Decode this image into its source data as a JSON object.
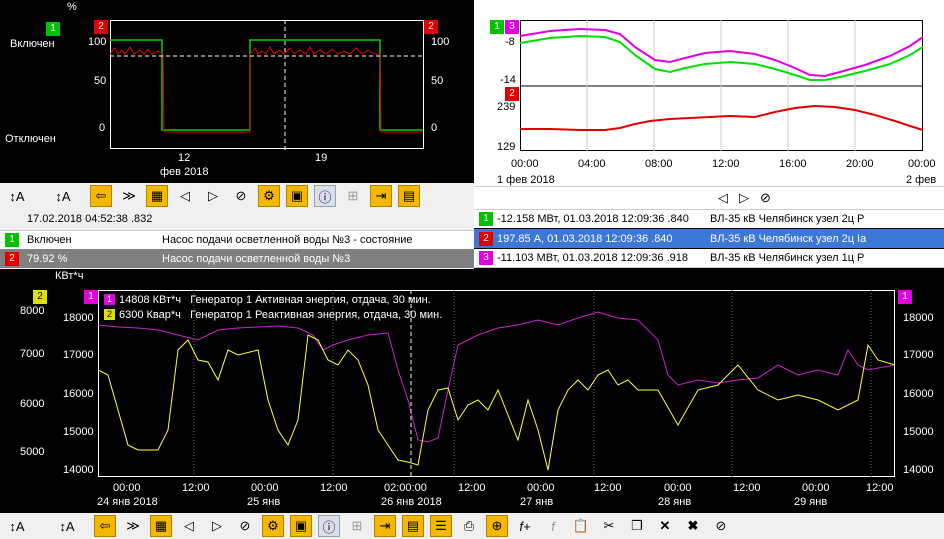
{
  "colors": {
    "green": "#00e000",
    "red": "#e00000",
    "magenta": "#e000e0",
    "yellow": "#ffff40",
    "blue_sel": "#3c78d8"
  },
  "top_left": {
    "unit": "%",
    "state_on": "Включен",
    "state_off": "Отключен",
    "ticks_left": [
      "100",
      "50",
      "0"
    ],
    "ticks_right": [
      "100",
      "50",
      "0"
    ],
    "x_ticks": [
      "12",
      "19"
    ],
    "x_sub": "фев 2018",
    "badge_left": "1",
    "badge_red": "2",
    "badge_right": "2"
  },
  "top_right": {
    "ticks_top": [
      "-8",
      "-14"
    ],
    "ticks_bottom": [
      "239",
      "129"
    ],
    "x_ticks": [
      "00:00",
      "04:00",
      "08:00",
      "12:00",
      "16:00",
      "20:00",
      "00:00"
    ],
    "date_left": "1 фев 2018",
    "date_right": "2 фев",
    "badge_a": "1",
    "badge_b": "3",
    "badge_c": "2"
  },
  "left_table": {
    "timestamp": "17.02.2018 04:52:38 .832",
    "rows": [
      {
        "badge": "1",
        "value": "Включен",
        "name": "Насос подачи осветленной воды №3 - состояние"
      },
      {
        "badge": "2",
        "value": "79.92 %",
        "name": "Насос подачи осветленной воды №3"
      }
    ]
  },
  "right_table": {
    "rows": [
      {
        "badge": "1",
        "value": "-12.158 МВт,  01.03.2018 12:09:36 .840",
        "name": "ВЛ-35 кВ Челябинск узел 2ц Р"
      },
      {
        "badge": "2",
        "value": "197.85 А,  01.03.2018 12:09:36 .840",
        "name": "ВЛ-35 кВ Челябинск узел 2ц Ia"
      },
      {
        "badge": "3",
        "value": "-11.103 МВт,  01.03.2018 12:09:36 .918",
        "name": "ВЛ-35 кВ Челябинск узел 1ц Р"
      }
    ]
  },
  "bottom": {
    "unit": "КВт*ч",
    "badge_left": "2",
    "badge_right": "1",
    "ticks_left": [
      "8000",
      "7000",
      "6000",
      "5000"
    ],
    "ticks_inner": [
      "18000",
      "17000",
      "16000",
      "15000",
      "14000"
    ],
    "ticks_right": [
      "18000",
      "17000",
      "16000",
      "15000",
      "14000"
    ],
    "legend": [
      {
        "badge": "1",
        "text": "14808 КВт*ч   Генератор 1 Активная энергия, отдача, 30 мин."
      },
      {
        "badge": "2",
        "text": "6300 Квар*ч   Генератор 1 Реактивная энергия, отдача, 30 мин."
      }
    ],
    "x_ticks": [
      "00:00",
      "12:00",
      "00:00",
      "12:00",
      "02:00:00",
      "12:00",
      "00:00",
      "12:00",
      "00:00",
      "12:00",
      "00:00",
      "12:00"
    ],
    "x_dates": [
      "24 янв 2018",
      "25 янв",
      "26 янв 2018",
      "27 янв",
      "28 янв",
      "29 янв"
    ]
  },
  "icons": [
    "sort-a-icon",
    "sort-a-icon",
    "back-arrow-icon",
    "fast-forward-icon",
    "calendar-icon",
    "prev-icon",
    "next-icon",
    "stop-icon",
    "settings-icon",
    "image-settings-icon",
    "info-icon",
    "add-icon",
    "export-icon",
    "table-icon",
    "split-icon",
    "print-icon",
    "new-page-icon",
    "function-icon",
    "function-disabled-icon",
    "paste-icon",
    "cut-icon",
    "copy-icon",
    "delete-icon",
    "delete-all-icon",
    "hide-icon"
  ]
}
